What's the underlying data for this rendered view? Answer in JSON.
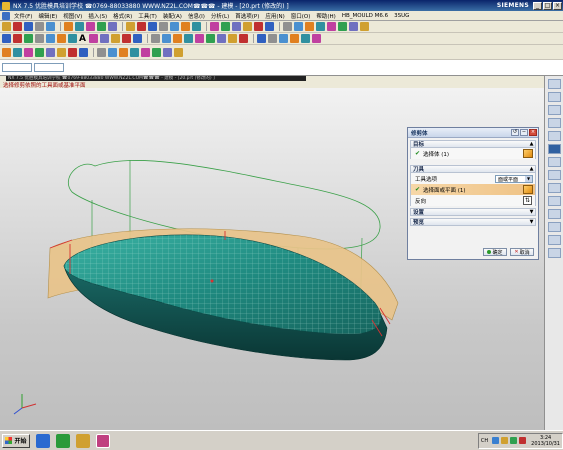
{
  "window": {
    "title": "NX 7.5 优胜模具培训学校  ☎0769-88033880  WWW.NZ2L.COM☎☎☎ - 建模 - [20.prt (修改的) ]",
    "brand": "SIEMENS",
    "controls": [
      "_",
      "□",
      "×"
    ]
  },
  "menubar": {
    "items": [
      "文件(F)",
      "编辑(E)",
      "视图(V)",
      "插入(S)",
      "格式(R)",
      "工具(T)",
      "装配(A)",
      "信息(I)",
      "分析(L)",
      "首选项(P)",
      "应用(N)",
      "窗口(O)",
      "帮助(H)",
      "HB_MOULD M6.6",
      "3SUG"
    ]
  },
  "toolbar2": {
    "text_label": "A"
  },
  "statusbar": {
    "ghost_title": "NX 7.5 优胜模具培训学校  ☎0769-88033880  WWW.NZ2L.COM☎☎☎ - 建模 - [20.prt (修改的) ]",
    "cue": "选择修剪依照的工具面或基准平面"
  },
  "dialog": {
    "title": "修剪体",
    "target_section": "目标",
    "target_row": "选择体 (1)",
    "tool_section": "刀具",
    "tool_option_label": "工具选项",
    "tool_option_value": "面或平面",
    "tool_face_row": "选择面或平面 (1)",
    "reverse_label": "反向",
    "settings_section": "设置",
    "preview_section": "预览",
    "ok": "确定",
    "cancel": "取消"
  },
  "taskbar": {
    "start": "开始",
    "lang": "CH",
    "time": "3:24",
    "date": "2013/10/31"
  },
  "colors": {
    "face_top": "#1f8a80",
    "face_side": "#0e4a48",
    "trim_surface": "#e9c48a",
    "wireframe": "#2a9a3a",
    "selection": "#d83030"
  }
}
